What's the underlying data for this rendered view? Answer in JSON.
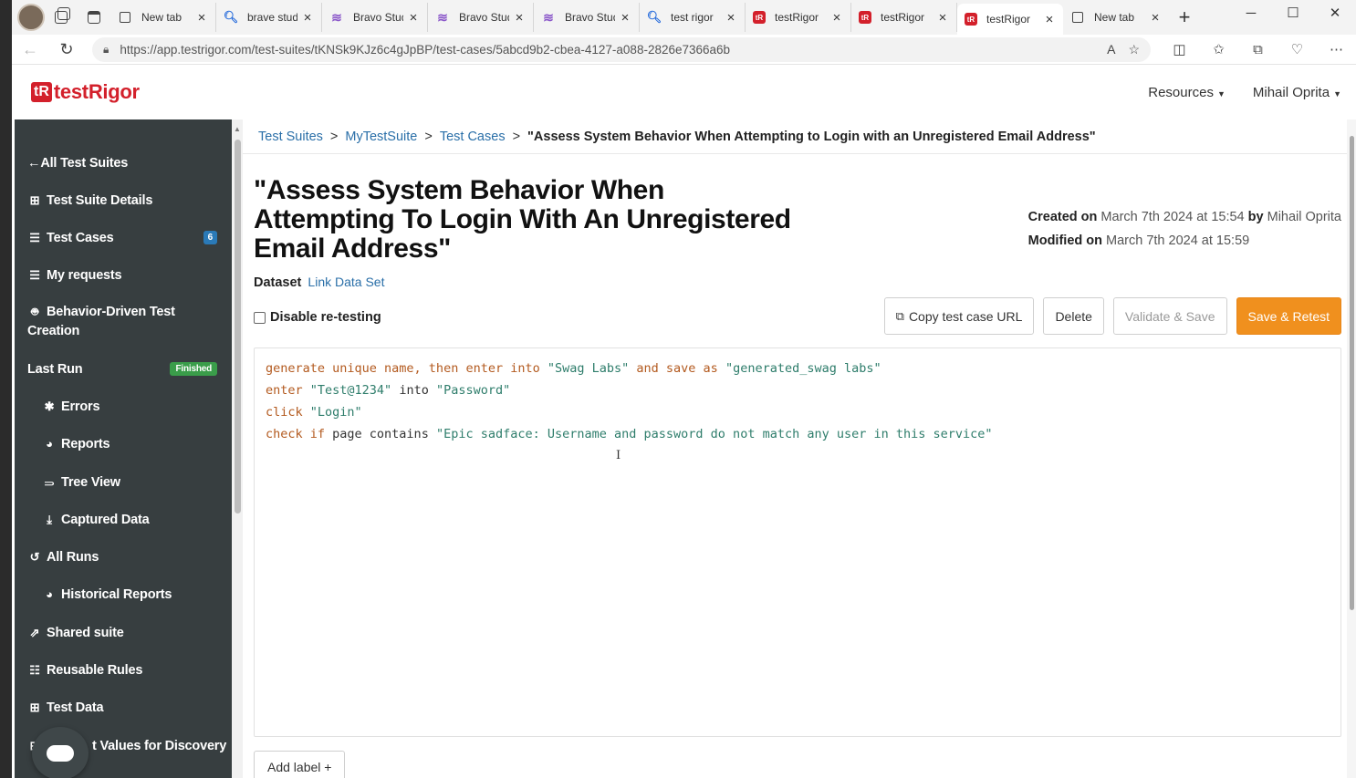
{
  "browser": {
    "tabs": [
      {
        "title": "New tab",
        "icon": "page-icon"
      },
      {
        "title": "brave stud",
        "icon": "search-icon"
      },
      {
        "title": "Bravo Stud",
        "icon": "bravo-icon"
      },
      {
        "title": "Bravo Stud",
        "icon": "bravo-icon"
      },
      {
        "title": "Bravo Stud",
        "icon": "bravo-icon"
      },
      {
        "title": "test rigor",
        "icon": "search-icon"
      },
      {
        "title": "testRigor",
        "icon": "testrigor-icon"
      },
      {
        "title": "testRigor",
        "icon": "testrigor-icon"
      },
      {
        "title": "testRigor",
        "icon": "testrigor-icon",
        "active": true
      },
      {
        "title": "New tab",
        "icon": "page-icon"
      }
    ],
    "url": "https://app.testrigor.com/test-suites/tKNSk9KJz6c4gJpBP/test-cases/5abcd9b2-cbea-4127-a088-2826e7366a6b"
  },
  "header": {
    "logo_mark": "tR",
    "logo_text": "testRigor",
    "resources": "Resources",
    "user": "Mihail Oprita"
  },
  "sidebar": {
    "all_test_suites": "All Test Suites",
    "test_suite_details": "Test Suite Details",
    "test_cases": "Test Cases",
    "test_cases_count": "6",
    "my_requests": "My requests",
    "bdd_line1": "Behavior-Driven Test",
    "bdd_line2": "Creation",
    "last_run": "Last Run",
    "last_run_status": "Finished",
    "errors": "Errors",
    "reports": "Reports",
    "tree_view": "Tree View",
    "captured_data": "Captured Data",
    "all_runs": "All Runs",
    "historical_reports": "Historical Reports",
    "shared_suite": "Shared suite",
    "reusable_rules": "Reusable Rules",
    "test_data": "Test Data",
    "discovery_values": "t Values for Discovery"
  },
  "breadcrumb": {
    "suites": "Test Suites",
    "suite": "MyTestSuite",
    "cases": "Test Cases",
    "current": "\"Assess System Behavior When Attempting to Login with an Unregistered Email Address\"",
    "separator": ">"
  },
  "test_case": {
    "title": "\"Assess System Behavior When Attempting To Login With An Unregistered Email Address\"",
    "dataset_label": "Dataset",
    "dataset_link": "Link Data Set",
    "created_label": "Created on",
    "created_date": "March 7th 2024 at 15:54",
    "by_label": "by",
    "created_by": "Mihail Oprita",
    "modified_label": "Modified on",
    "modified_date": "March 7th 2024 at 15:59",
    "disable_retesting": "Disable re-testing"
  },
  "actions": {
    "copy_url": "Copy test case URL",
    "delete": "Delete",
    "validate_save": "Validate & Save",
    "save_retest": "Save & Retest"
  },
  "code": {
    "line1": {
      "k1": "generate unique name, then enter into ",
      "s1": "\"Swag Labs\"",
      "k2": " and save as ",
      "s2": "\"generated_swag labs\""
    },
    "line2": {
      "k1": "enter ",
      "s1": "\"Test@1234\"",
      "p1": " into ",
      "s2": "\"Password\""
    },
    "line3": {
      "k1": "click ",
      "s1": "\"Login\""
    },
    "line4": {
      "k1": "check if ",
      "p1": "page contains ",
      "s1": "\"Epic sadface: Username and password do not match any user in this service\""
    }
  },
  "footer": {
    "add_label": "Add label +"
  },
  "colors": {
    "sidebar_bg": "#373e40",
    "brand_red": "#d3202b",
    "primary_orange": "#f0901e",
    "link_blue": "#2a6fa8",
    "status_green": "#3a9d4a"
  }
}
